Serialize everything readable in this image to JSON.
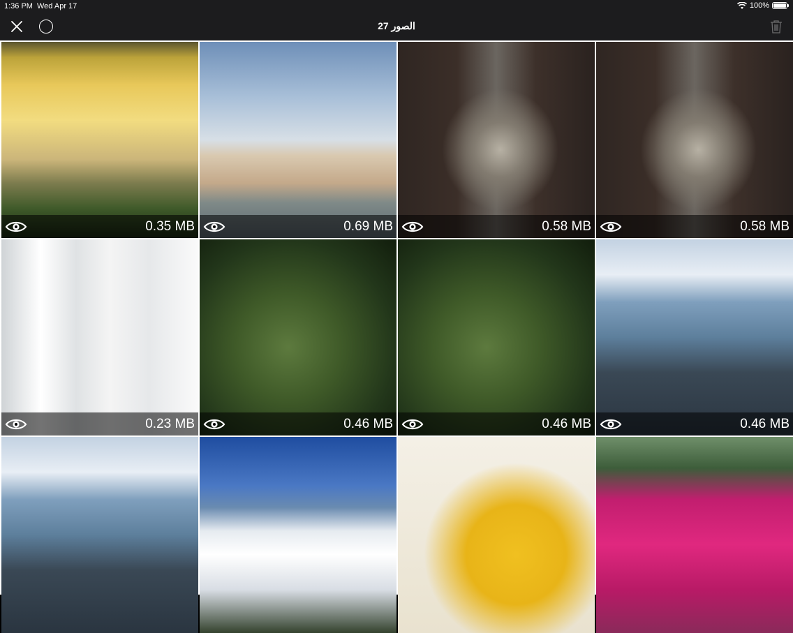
{
  "status": {
    "time": "1:36 PM",
    "date": "Wed Apr 17",
    "battery": "100%"
  },
  "nav": {
    "title": "الصور 27",
    "close_icon": "close-icon",
    "select_icon": "circle-icon",
    "trash_icon": "trash-icon"
  },
  "photos": [
    {
      "name": "photo-sunset-hills",
      "size": "0.35 MB",
      "scene": "sunset"
    },
    {
      "name": "photo-parliament",
      "size": "0.69 MB",
      "scene": "parliament"
    },
    {
      "name": "photo-bridge-street-1",
      "size": "0.58 MB",
      "scene": "bridge"
    },
    {
      "name": "photo-bridge-street-2",
      "size": "0.58 MB",
      "scene": "bridge"
    },
    {
      "name": "photo-woman-train",
      "size": "0.23 MB",
      "scene": "train"
    },
    {
      "name": "photo-leaf-1",
      "size": "0.46 MB",
      "scene": "leaf"
    },
    {
      "name": "photo-leaf-2",
      "size": "0.46 MB",
      "scene": "leaf"
    },
    {
      "name": "photo-rocky-shore-1",
      "size": "0.46 MB",
      "scene": "shore"
    },
    {
      "name": "photo-rocky-shore-2",
      "size": "",
      "scene": "shore"
    },
    {
      "name": "photo-mountain-clouds",
      "size": "",
      "scene": "mountains"
    },
    {
      "name": "photo-yellow-flower",
      "size": "",
      "scene": "yellow"
    },
    {
      "name": "photo-pink-flowers",
      "size": "",
      "scene": "pink"
    }
  ]
}
